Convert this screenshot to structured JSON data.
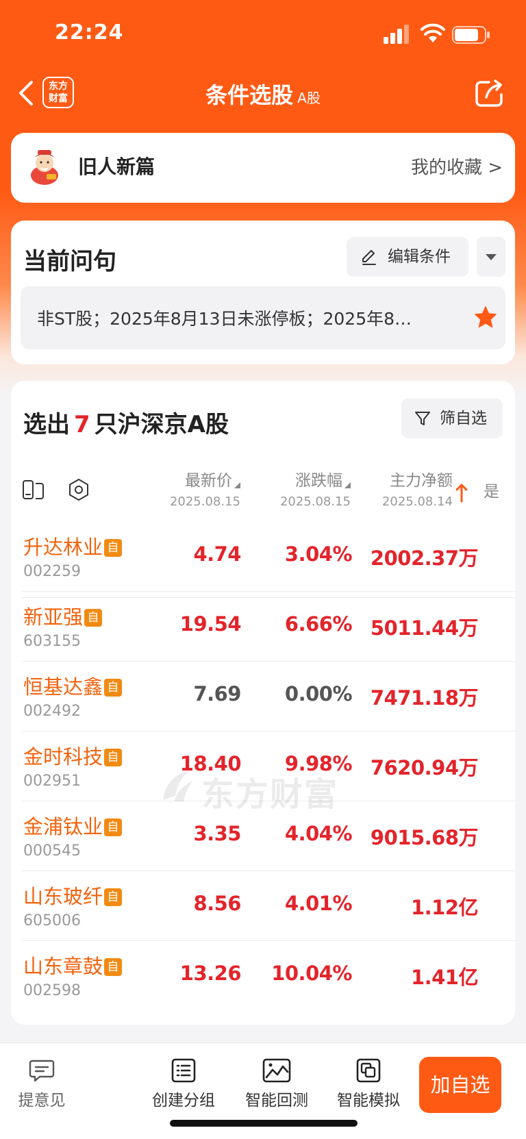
{
  "status_bar": {
    "time": "22:24"
  },
  "nav": {
    "title": "条件选股",
    "title_sub": "A股",
    "logo_line1": "东方",
    "logo_line2": "财富"
  },
  "favorite": {
    "name": "旧人新篇",
    "link": "我的收藏 >"
  },
  "query": {
    "title": "当前问句",
    "edit_label": "编辑条件",
    "text": "非ST股；2025年8月13日未涨停板；2025年8…"
  },
  "results": {
    "prefix": "选出",
    "count": "7",
    "suffix": "只沪深京A股",
    "filter_label": "筛自选",
    "columns": {
      "price": {
        "label": "最新价",
        "date": "2025.08.15"
      },
      "change": {
        "label": "涨跌幅",
        "date": "2025.08.15"
      },
      "net": {
        "label": "主力净额",
        "date": "2025.08.14"
      },
      "more": "是"
    },
    "tag": "自",
    "rows": [
      {
        "name": "升达林业",
        "code": "002259",
        "price": "4.74",
        "change": "3.04%",
        "net": "2002.37万"
      },
      {
        "name": "新亚强",
        "code": "603155",
        "price": "19.54",
        "change": "6.66%",
        "net": "5011.44万"
      },
      {
        "name": "恒基达鑫",
        "code": "002492",
        "price": "7.69",
        "change": "0.00%",
        "net": "7471.18万"
      },
      {
        "name": "金时科技",
        "code": "002951",
        "price": "18.40",
        "change": "9.98%",
        "net": "7620.94万"
      },
      {
        "name": "金浦钛业",
        "code": "000545",
        "price": "3.35",
        "change": "4.04%",
        "net": "9015.68万"
      },
      {
        "name": "山东玻纤",
        "code": "605006",
        "price": "8.56",
        "change": "4.01%",
        "net": "1.12亿"
      },
      {
        "name": "山东章鼓",
        "code": "002598",
        "price": "13.26",
        "change": "10.04%",
        "net": "1.41亿"
      }
    ]
  },
  "watermark": "东方财富",
  "tabbar": {
    "feedback": "提意见",
    "group": "创建分组",
    "backtest": "智能回测",
    "simulate": "智能模拟",
    "add": "加自选"
  },
  "colors": {
    "brand": "#ff5a14",
    "up": "#e3242b",
    "name": "#f2630e"
  }
}
